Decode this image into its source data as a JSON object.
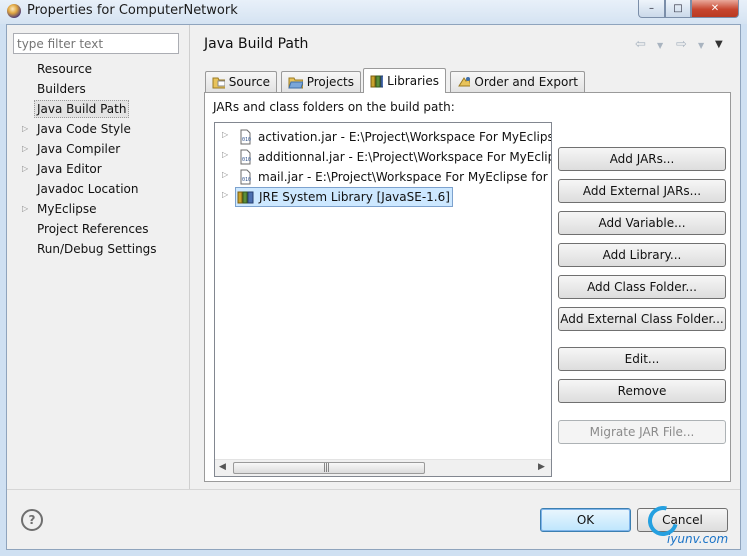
{
  "window": {
    "title": "Properties for ComputerNetwork",
    "minimize": "–",
    "maximize": "□",
    "close": "✕"
  },
  "filter": {
    "placeholder": "type filter text"
  },
  "nav": {
    "items": [
      {
        "label": "Resource",
        "expandable": false
      },
      {
        "label": "Builders",
        "expandable": false
      },
      {
        "label": "Java Build Path",
        "expandable": false,
        "selected": true
      },
      {
        "label": "Java Code Style",
        "expandable": true
      },
      {
        "label": "Java Compiler",
        "expandable": true
      },
      {
        "label": "Java Editor",
        "expandable": true
      },
      {
        "label": "Javadoc Location",
        "expandable": false
      },
      {
        "label": "MyEclipse",
        "expandable": true
      },
      {
        "label": "Project References",
        "expandable": false
      },
      {
        "label": "Run/Debug Settings",
        "expandable": false
      }
    ]
  },
  "page": {
    "title": "Java Build Path",
    "history": {
      "back": "⇦",
      "forward": "⇨",
      "dropdown": "▼",
      "menu": "▼"
    }
  },
  "tabs": [
    {
      "label": "Source",
      "icon": "source-folder-icon"
    },
    {
      "label": "Projects",
      "icon": "projects-folder-icon"
    },
    {
      "label": "Libraries",
      "icon": "libraries-icon",
      "active": true
    },
    {
      "label": "Order and Export",
      "icon": "order-export-icon"
    }
  ],
  "libraries": {
    "label": "JARs and class folders on the build path:",
    "entries": [
      {
        "text": "activation.jar - E:\\Project\\Workspace For MyEclipse",
        "icon": "jar-icon"
      },
      {
        "text": "additionnal.jar - E:\\Project\\Workspace For MyEclip",
        "icon": "jar-icon"
      },
      {
        "text": "mail.jar - E:\\Project\\Workspace For MyEclipse for",
        "icon": "jar-icon"
      },
      {
        "text": "JRE System Library [JavaSE-1.6]",
        "icon": "jre-library-icon",
        "selected": true
      }
    ],
    "scrollbar": {
      "left": "◀",
      "right": "▶",
      "grip": "|||"
    },
    "buttons": [
      {
        "label": "Add JARs...",
        "name": "add-jars-button",
        "enabled": true
      },
      {
        "label": "Add External JARs...",
        "name": "add-external-jars-button",
        "enabled": true
      },
      {
        "label": "Add Variable...",
        "name": "add-variable-button",
        "enabled": true
      },
      {
        "label": "Add Library...",
        "name": "add-library-button",
        "enabled": true
      },
      {
        "label": "Add Class Folder...",
        "name": "add-class-folder-button",
        "enabled": true
      },
      {
        "label": "Add External Class Folder...",
        "name": "add-external-class-folder-button",
        "enabled": true
      },
      {
        "label": "Edit...",
        "name": "edit-button",
        "enabled": true
      },
      {
        "label": "Remove",
        "name": "remove-button",
        "enabled": true
      },
      {
        "label": "Migrate JAR File...",
        "name": "migrate-jar-file-button",
        "enabled": false
      }
    ]
  },
  "footer": {
    "help": "?",
    "ok": "OK",
    "cancel": "Cancel"
  },
  "watermark": {
    "text": "iyunv.com"
  },
  "colors": {
    "accent": "#3c7fb1",
    "selection": "#cde8ff",
    "titlebar": "#d5e3f2",
    "close_button": "#c7462f"
  }
}
